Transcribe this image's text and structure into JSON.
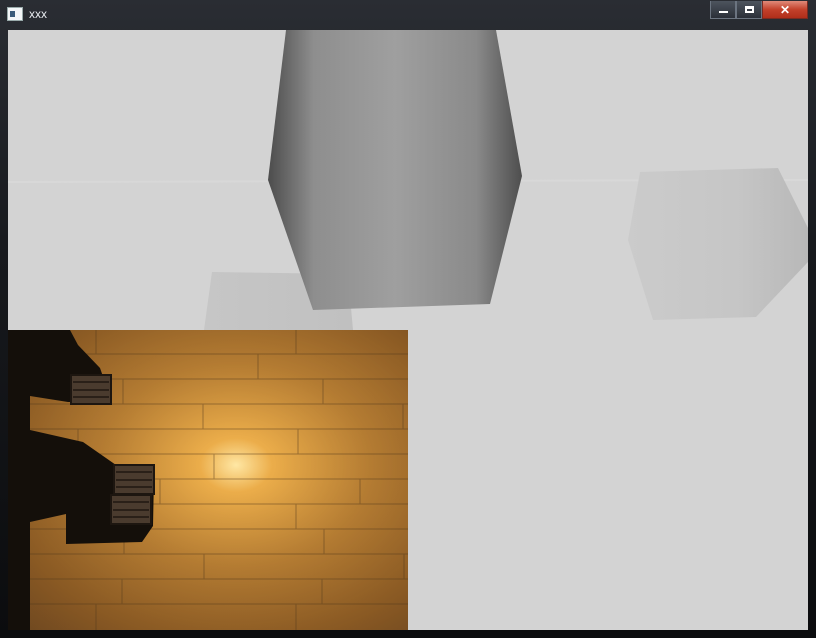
{
  "window": {
    "title": "xxx",
    "controls": {
      "minimize": "minimize",
      "maximize": "maximize",
      "close": "close"
    }
  },
  "scene": {
    "background_color": "#d3d3d3",
    "objects": [
      "large-grey-cube",
      "small-grey-cube",
      "shadow-plane"
    ]
  },
  "floor_view": {
    "description_icon": "wood-floor-texture",
    "crates": 3
  }
}
